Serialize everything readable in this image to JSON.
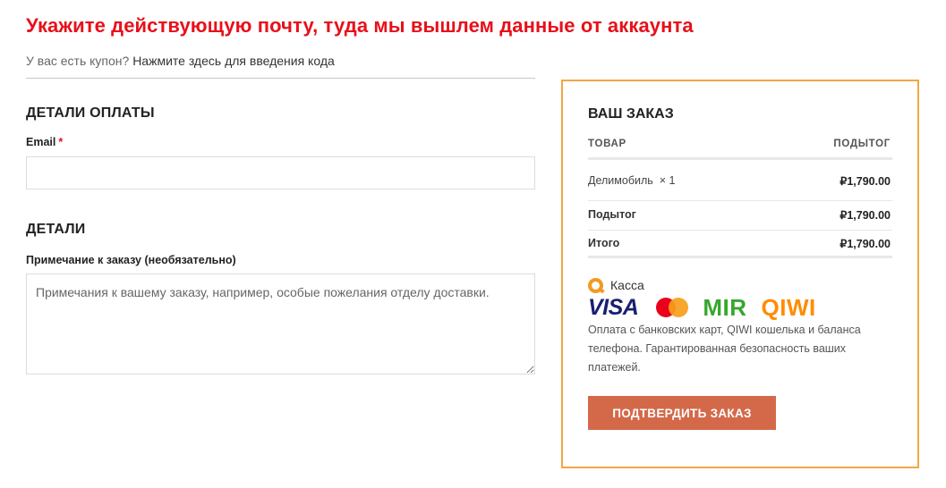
{
  "headline": "Укажите действующую почту, туда мы вышлем данные от аккаунта",
  "coupon": {
    "prefix": "У вас есть купон?",
    "link": "Нажмите здесь для введения кода"
  },
  "billing": {
    "title": "ДЕТАЛИ ОПЛАТЫ",
    "email_label": "Email",
    "email_required_mark": "*",
    "email_value": ""
  },
  "details": {
    "title": "ДЕТАЛИ",
    "notes_label": "Примечание к заказу (необязательно)",
    "notes_placeholder": "Примечания к вашему заказу, например, особые пожелания отделу доставки.",
    "notes_value": ""
  },
  "order": {
    "title": "ВАШ ЗАКАЗ",
    "col_product": "ТОВАР",
    "col_subtotal": "ПОДЫТОГ",
    "item_name": "Делимобиль",
    "item_qty": "× 1",
    "item_price": "₽1,790.00",
    "subtotal_label": "Подытог",
    "subtotal_value": "₽1,790.00",
    "total_label": "Итого",
    "total_value": "₽1,790.00"
  },
  "payment": {
    "provider": "Касса",
    "logos": {
      "visa": "VISA",
      "mir": "MIR",
      "qiwi": "QIWI"
    },
    "description": "Оплата с банковских карт, QIWI кошелька и баланса телефона. Гарантированная безопасность ваших платежей.",
    "button": "ПОДТВЕРДИТЬ ЗАКАЗ"
  },
  "colors": {
    "headline": "#e8101a",
    "box_border": "#f2a742",
    "button": "#d4694a",
    "visa": "#1a1f71",
    "mir": "#37a72e",
    "qiwi": "#ff8c00"
  }
}
